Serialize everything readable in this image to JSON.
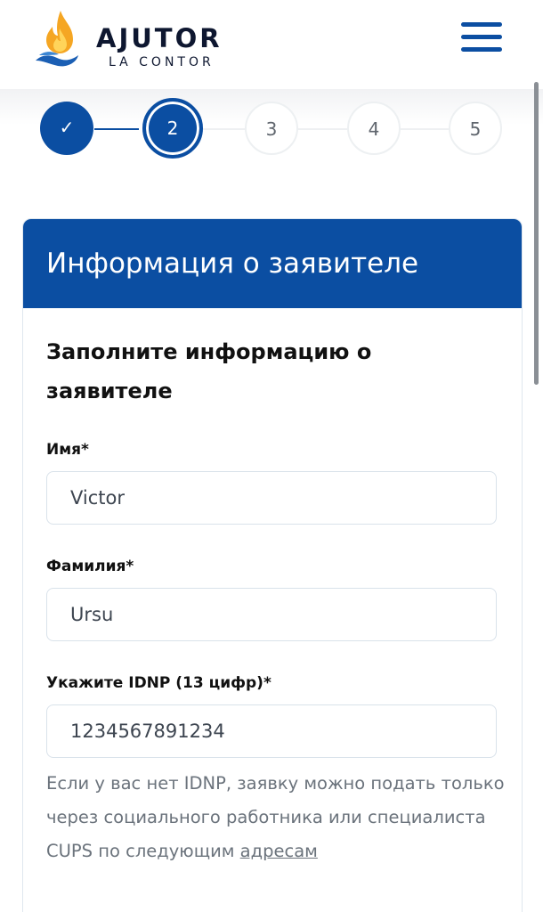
{
  "header": {
    "logo_title": "AJUTOR",
    "logo_subtitle": "LA CONTOR",
    "menu_icon": "hamburger-menu-icon"
  },
  "stepper": {
    "steps": [
      {
        "label": "✓",
        "state": "done"
      },
      {
        "label": "2",
        "state": "current"
      },
      {
        "label": "3",
        "state": "pending"
      },
      {
        "label": "4",
        "state": "pending"
      },
      {
        "label": "5",
        "state": "pending"
      }
    ]
  },
  "card": {
    "title": "Информация о заявителе",
    "section_title": "Заполните информацию о заявителе",
    "fields": {
      "first_name": {
        "label": "Имя*",
        "value": "Victor"
      },
      "last_name": {
        "label": "Фамилия*",
        "value": "Ursu"
      },
      "idnp": {
        "label": "Укажите IDNP (13 цифр)*",
        "value": "1234567891234"
      }
    },
    "hint_text": "Если у вас нет IDNP, заявку можно подать только через социального работника или специалиста CUPS по следующим ",
    "hint_link": "адресам"
  },
  "colors": {
    "brand_blue": "#0b4ea2",
    "text_dark": "#111111",
    "hint_gray": "#6b737c"
  }
}
